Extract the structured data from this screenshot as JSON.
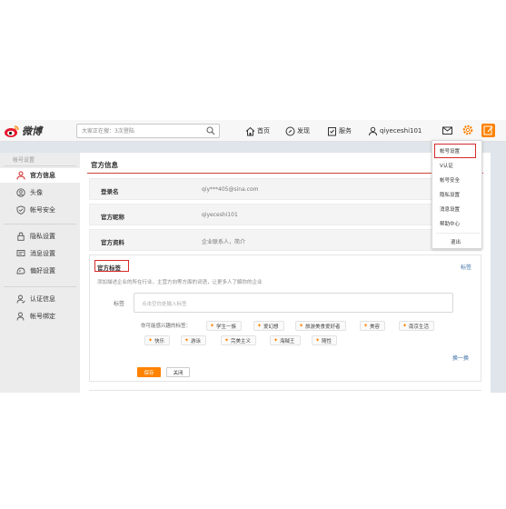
{
  "app": {
    "logo_text": "微博"
  },
  "search": {
    "placeholder": "大家正在搜：3次登陆"
  },
  "nav": {
    "home": "首页",
    "discover": "发现",
    "service": "服务",
    "username": "qiyeceshi101"
  },
  "sidebar": {
    "header": "帐号设置",
    "items": [
      {
        "label": "官方信息",
        "icon": "user-icon",
        "active": true
      },
      {
        "label": "头像",
        "icon": "avatar-icon",
        "active": false
      },
      {
        "label": "帐号安全",
        "icon": "shield-icon",
        "active": false
      },
      {
        "label": "隐私设置",
        "icon": "lock-icon",
        "active": false
      },
      {
        "label": "消息设置",
        "icon": "message-icon",
        "active": false
      },
      {
        "label": "偏好设置",
        "icon": "preference-icon",
        "active": false
      },
      {
        "label": "认证信息",
        "icon": "verify-icon",
        "active": false
      },
      {
        "label": "帐号绑定",
        "icon": "bind-icon",
        "active": false
      }
    ]
  },
  "main": {
    "title": "官方信息",
    "rows": [
      {
        "label": "登录名",
        "value": "qiy***405@sina.com"
      },
      {
        "label": "官方昵称",
        "value": "qiyeceshi101"
      },
      {
        "label": "官方资料",
        "value": "企业联系人，简介"
      }
    ]
  },
  "tags": {
    "title": "官方标签",
    "edit_link": "标签",
    "description": "添加描述企业的所在行业，主营方向等方面的词语，让更多人了解你的企业",
    "input_label": "标签",
    "input_placeholder": "点击空白处输入标签",
    "interest_title": "你可能感兴趣的标签：",
    "chips_row1": [
      "学生一族",
      "爱幻想",
      "旅游美食爱好者",
      "美容",
      "南京生活"
    ],
    "chips_row2": [
      "快乐",
      "游泳",
      "完美主义",
      "海贼王",
      "随性"
    ],
    "refresh": "换一换",
    "save": "保存",
    "close": "关闭"
  },
  "dropdown": {
    "items": [
      "帐号设置",
      "V认证",
      "帐号安全",
      "隐私设置",
      "消息设置",
      "帮助中心",
      "退出"
    ]
  },
  "colors": {
    "accent": "#ff8200",
    "highlight": "#d42a2a",
    "link": "#3a6ea5"
  }
}
